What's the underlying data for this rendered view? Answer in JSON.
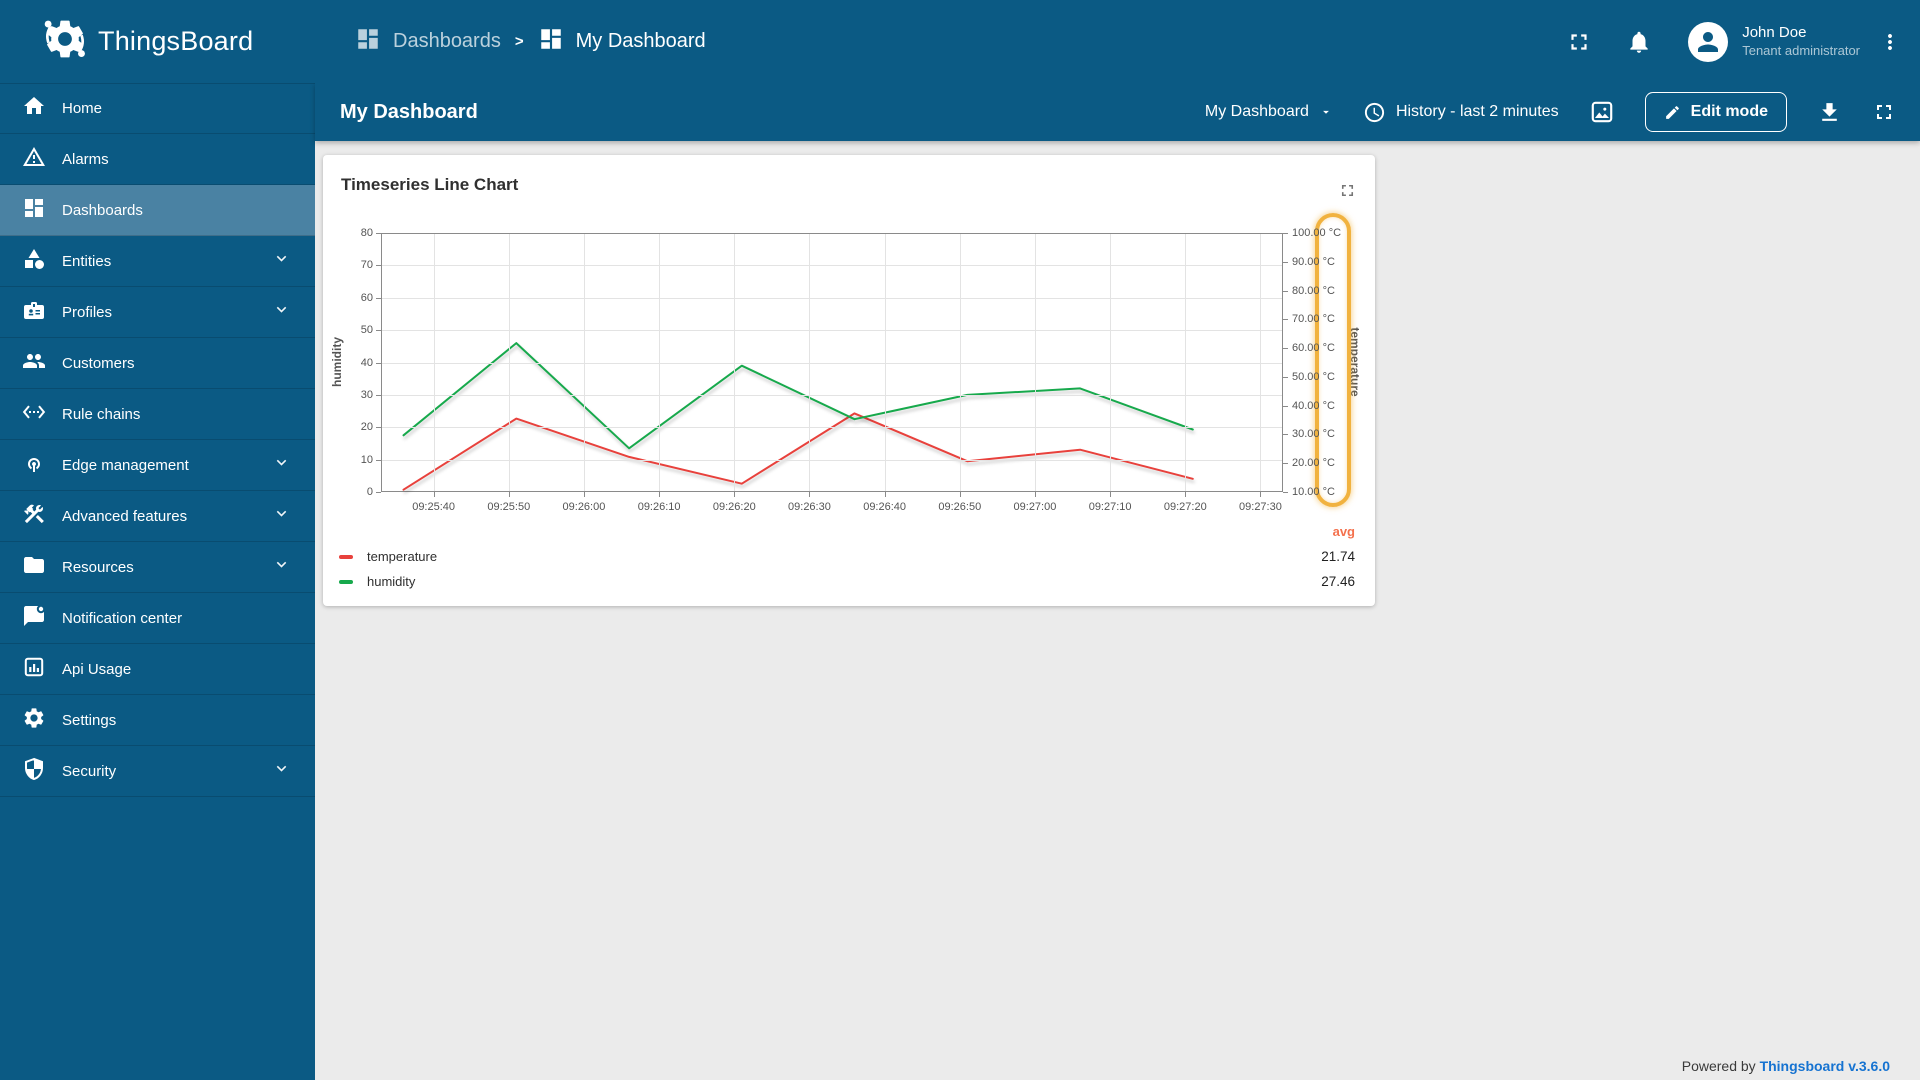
{
  "colors": {
    "primary": "#0b5a84",
    "primary_active": "#4a82a3",
    "content_bg": "#ebebeb",
    "link": "#1673d1",
    "temperature": "#e8413c",
    "humidity": "#17a94c",
    "avg": "#f4714d",
    "annotation": "#f1b23f"
  },
  "topbar": {
    "product": "ThingsBoard",
    "breadcrumb": {
      "parent": "Dashboards",
      "separator": ">",
      "current": "My Dashboard"
    },
    "user": {
      "name": "John Doe",
      "role": "Tenant administrator"
    },
    "icons": [
      "thingsboard-logo-icon",
      "dashboards-icon",
      "fullscreen-icon",
      "notifications-icon",
      "avatar-icon",
      "more-vert-icon"
    ]
  },
  "sidebar": {
    "items": [
      {
        "label": "Home",
        "icon": "home-icon",
        "expandable": false,
        "active": false
      },
      {
        "label": "Alarms",
        "icon": "alarms-icon",
        "expandable": false,
        "active": false
      },
      {
        "label": "Dashboards",
        "icon": "dashboards-icon",
        "expandable": false,
        "active": true
      },
      {
        "label": "Entities",
        "icon": "entities-icon",
        "expandable": true,
        "active": false
      },
      {
        "label": "Profiles",
        "icon": "profiles-icon",
        "expandable": true,
        "active": false
      },
      {
        "label": "Customers",
        "icon": "customers-icon",
        "expandable": false,
        "active": false
      },
      {
        "label": "Rule chains",
        "icon": "rule-chains-icon",
        "expandable": false,
        "active": false
      },
      {
        "label": "Edge management",
        "icon": "edge-management-icon",
        "expandable": true,
        "active": false
      },
      {
        "label": "Advanced features",
        "icon": "advanced-features-icon",
        "expandable": true,
        "active": false
      },
      {
        "label": "Resources",
        "icon": "resources-icon",
        "expandable": true,
        "active": false
      },
      {
        "label": "Notification center",
        "icon": "notification-center-icon",
        "expandable": false,
        "active": false
      },
      {
        "label": "Api Usage",
        "icon": "api-usage-icon",
        "expandable": false,
        "active": false
      },
      {
        "label": "Settings",
        "icon": "settings-icon",
        "expandable": false,
        "active": false
      },
      {
        "label": "Security",
        "icon": "security-icon",
        "expandable": true,
        "active": false
      }
    ]
  },
  "toolbar": {
    "title": "My Dashboard",
    "dashboard_selector": "My Dashboard",
    "history": "History - last 2 minutes",
    "edit_mode": "Edit mode",
    "icons": [
      "chevron-down-icon",
      "clock-icon",
      "image-icon",
      "edit-icon",
      "download-icon",
      "fullscreen-icon"
    ]
  },
  "widget": {
    "title": "Timeseries Line Chart",
    "icons": [
      "expand-icon"
    ]
  },
  "chart_data": {
    "type": "line",
    "title": "Timeseries Line Chart",
    "x_window": {
      "start_label": "09:25:33",
      "span_seconds": 120
    },
    "x_ticks": {
      "offsets_s": [
        7,
        17,
        27,
        37,
        47,
        57,
        67,
        77,
        87,
        97,
        107,
        117
      ],
      "labels": [
        "09:25:40",
        "09:25:50",
        "09:26:00",
        "09:26:10",
        "09:26:20",
        "09:26:30",
        "09:26:40",
        "09:26:50",
        "09:27:00",
        "09:27:10",
        "09:27:20",
        "09:27:30"
      ]
    },
    "y_left": {
      "label": "humidity",
      "min": 0,
      "max": 80,
      "ticks": [
        0,
        10,
        20,
        30,
        40,
        50,
        60,
        70,
        80
      ]
    },
    "y_right": {
      "label": "temperature",
      "min": 10,
      "max": 100,
      "tick_values": [
        10,
        20,
        30,
        40,
        50,
        60,
        70,
        80,
        90,
        100
      ],
      "tick_labels": [
        "10.00 °C",
        "20.00 °C",
        "30.00 °C",
        "40.00 °C",
        "50.00 °C",
        "60.00 °C",
        "70.00 °C",
        "80.00 °C",
        "90.00 °C",
        "100.00 °C"
      ]
    },
    "series": [
      {
        "name": "temperature",
        "axis": "right",
        "color": "#e8413c",
        "avg": "21.74",
        "x_offsets_s": [
          3,
          18,
          33,
          48,
          63,
          78,
          93,
          108
        ],
        "values": [
          10.8,
          35.5,
          22.2,
          12.9,
          37.3,
          20.7,
          24.7,
          14.6
        ]
      },
      {
        "name": "humidity",
        "axis": "left",
        "color": "#17a94c",
        "avg": "27.46",
        "x_offsets_s": [
          3,
          18,
          33,
          48,
          63,
          78,
          93,
          108
        ],
        "values": [
          17.5,
          46,
          13.5,
          39,
          22.5,
          30,
          32,
          19.3
        ]
      }
    ],
    "legend": {
      "avg_header": "avg",
      "position": "bottom"
    },
    "grid": true,
    "annotation": {
      "type": "highlight-oval",
      "around": "right-axis-tick-labels",
      "color": "#f1b23f"
    }
  },
  "footer": {
    "prefix": "Powered by",
    "link": "Thingsboard v.3.6.0"
  }
}
